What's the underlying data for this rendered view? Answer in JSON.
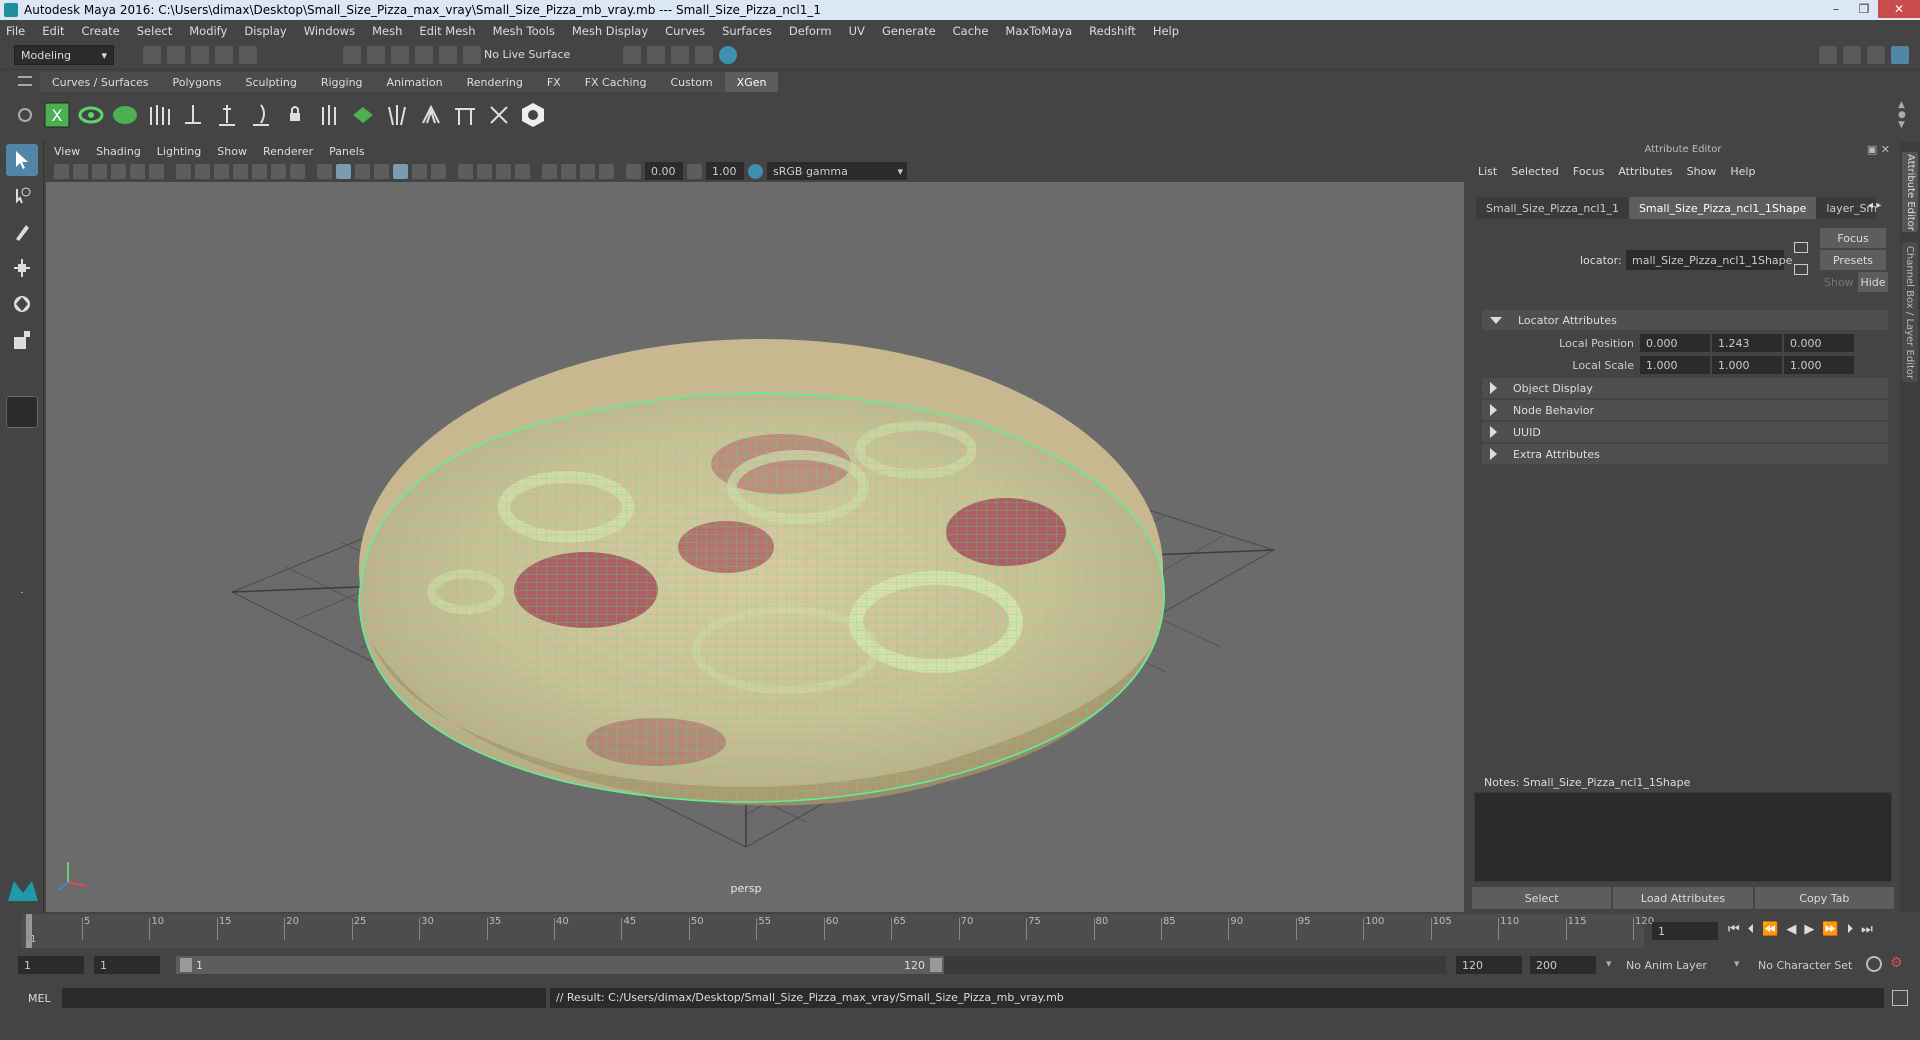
{
  "window": {
    "title": "Autodesk Maya 2016: C:\\Users\\dimax\\Desktop\\Small_Size_Pizza_max_vray\\Small_Size_Pizza_mb_vray.mb   ---   Small_Size_Pizza_ncl1_1",
    "controls": [
      "–",
      "❐",
      "✕"
    ]
  },
  "menubar": [
    "File",
    "Edit",
    "Create",
    "Select",
    "Modify",
    "Display",
    "Windows",
    "Mesh",
    "Edit Mesh",
    "Mesh Tools",
    "Mesh Display",
    "Curves",
    "Surfaces",
    "Deform",
    "UV",
    "Generate",
    "Cache",
    "MaxToMaya",
    "Redshift",
    "Help"
  ],
  "statusline": {
    "mode": "Modeling",
    "live_surface": "No Live Surface"
  },
  "shelf": {
    "tabs": [
      "Curves / Surfaces",
      "Polygons",
      "Sculpting",
      "Rigging",
      "Animation",
      "Rendering",
      "FX",
      "FX Caching",
      "Custom",
      "XGen"
    ],
    "active": "XGen"
  },
  "viewport": {
    "menu": [
      "View",
      "Shading",
      "Lighting",
      "Show",
      "Renderer",
      "Panels"
    ],
    "exposure": "0.00",
    "gamma": "1.00",
    "colorspace": "sRGB gamma",
    "camera_label": "persp"
  },
  "attribute_editor": {
    "title": "Attribute Editor",
    "menu": [
      "List",
      "Selected",
      "Focus",
      "Attributes",
      "Show",
      "Help"
    ],
    "tabs": [
      "Small_Size_Pizza_ncl1_1",
      "Small_Size_Pizza_ncl1_1Shape",
      "layer_Small"
    ],
    "active_tab": "Small_Size_Pizza_ncl1_1Shape",
    "locator_label": "locator:",
    "locator_value": "mall_Size_Pizza_ncl1_1Shape",
    "buttons": {
      "focus": "Focus",
      "presets": "Presets",
      "show": "Show",
      "hide": "Hide"
    },
    "sections": [
      {
        "label": "Locator Attributes",
        "open": true
      },
      {
        "label": "Object Display",
        "open": false
      },
      {
        "label": "Node Behavior",
        "open": false
      },
      {
        "label": "UUID",
        "open": false
      },
      {
        "label": "Extra Attributes",
        "open": false
      }
    ],
    "local_position": {
      "label": "Local Position",
      "values": [
        "0.000",
        "1.243",
        "0.000"
      ]
    },
    "local_scale": {
      "label": "Local Scale",
      "values": [
        "1.000",
        "1.000",
        "1.000"
      ]
    },
    "notes_label": "Notes:  Small_Size_Pizza_ncl1_1Shape",
    "bottom_buttons": [
      "Select",
      "Load Attributes",
      "Copy Tab"
    ],
    "side_tabs": [
      "Attribute Editor",
      "Channel Box / Layer Editor"
    ]
  },
  "timeline": {
    "ticks": [
      "1",
      "5",
      "10",
      "15",
      "20",
      "25",
      "30",
      "35",
      "40",
      "45",
      "50",
      "55",
      "60",
      "65",
      "70",
      "75",
      "80",
      "85",
      "90",
      "95",
      "100",
      "105",
      "110",
      "115",
      "120"
    ],
    "current_frame": "1"
  },
  "range": {
    "start": "1",
    "start2": "1",
    "slider_start": "1",
    "slider_end": "120",
    "end": "120",
    "end2": "200",
    "anim_layer": "No Anim Layer",
    "char_set": "No Character Set"
  },
  "cmdline": {
    "lang": "MEL",
    "result": "// Result: C:/Users/dimax/Desktop/Small_Size_Pizza_max_vray/Small_Size_Pizza_mb_vray.mb"
  }
}
